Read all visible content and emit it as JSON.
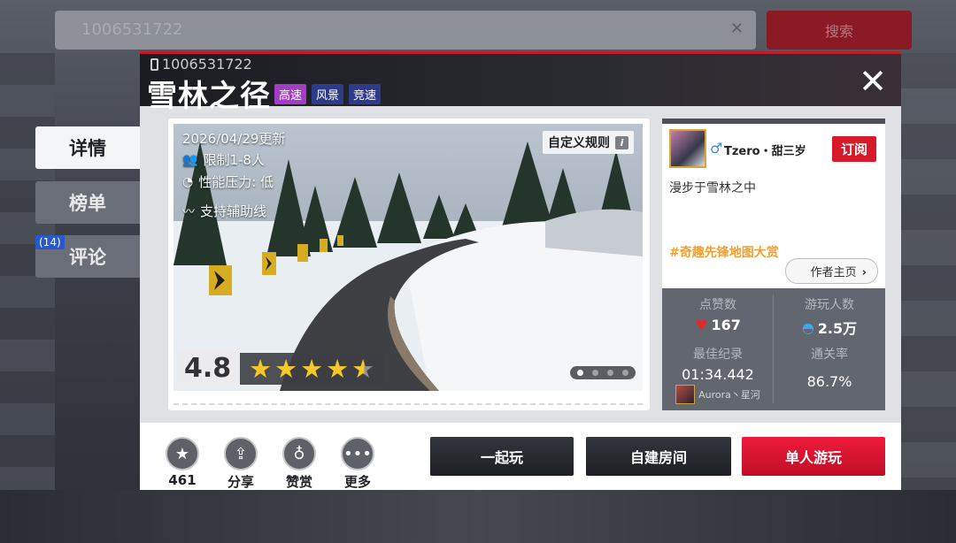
{
  "background": {
    "search_text": "1006531722",
    "search_button": "搜索",
    "clear_glyph": "✕"
  },
  "side_tabs": {
    "details": "详情",
    "leaderboard": "榜单",
    "comments": "评论",
    "comments_count": "(14)"
  },
  "header": {
    "map_id": "1006531722",
    "title": "雪林之径",
    "tags": [
      "高速",
      "风景",
      "竞速"
    ],
    "close_glyph": "✕"
  },
  "preview": {
    "updated": "2026/04/29更新",
    "players": "限制1-8人",
    "performance": "性能压力: 低",
    "assist": "支持辅助线",
    "custom_rules": "自定义规则",
    "info_glyph": "i",
    "rating": "4.8",
    "rating_value": 4.8,
    "slide_count": 4,
    "active_slide": 1
  },
  "author": {
    "name": "Tzero・甜三岁",
    "gender_glyph": "♂",
    "subscribe": "订阅",
    "description": "漫步于雪林之中",
    "hashtag": "#奇趣先锋地图大赏",
    "home_button": "作者主页"
  },
  "stats": {
    "likes_label": "点赞数",
    "likes_value": "167",
    "players_label": "游玩人数",
    "players_value": "2.5万",
    "record_label": "最佳纪录",
    "record_value": "01:34.442",
    "record_holder": "Aurora丶星河",
    "clear_rate_label": "通关率",
    "clear_rate_value": "86.7%"
  },
  "actions": {
    "favorite_count": "461",
    "share": "分享",
    "tip": "赞赏",
    "more": "更多",
    "play_together": "一起玩",
    "create_room": "自建房间",
    "solo_play": "单人游玩"
  },
  "colors": {
    "accent_red": "#d7192a",
    "tag_purple": "#a13ec5",
    "tag_navy": "#2e3a8a",
    "star_yellow": "#f6c829",
    "hashtag_orange": "#f0a032"
  }
}
